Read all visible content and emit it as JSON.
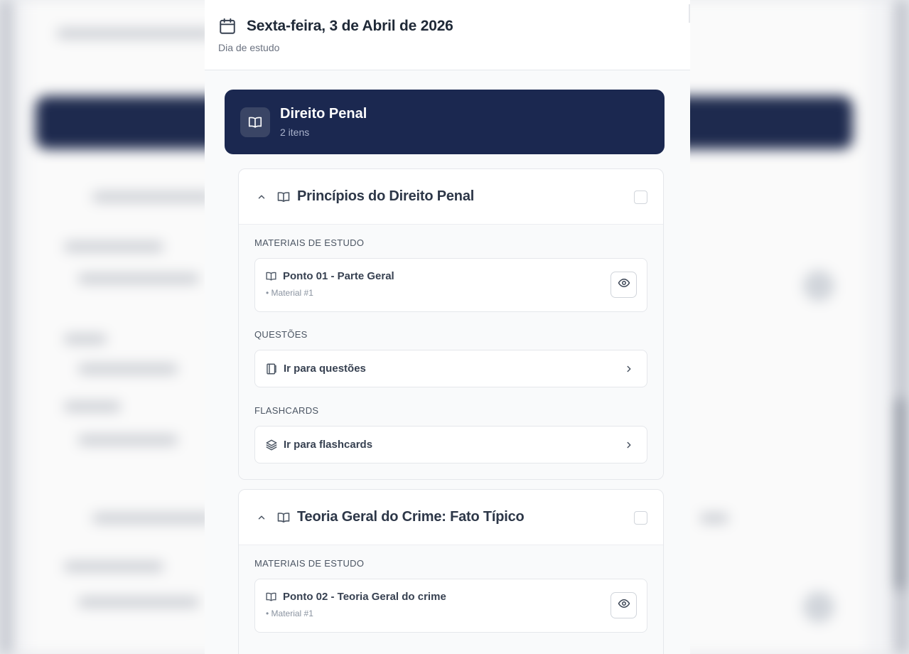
{
  "header": {
    "date_title": "Sexta-feira, 3 de Abril de 2026",
    "subtitle": "Dia de estudo",
    "icon": "calendar-icon"
  },
  "subject": {
    "title": "Direito Penal",
    "count": "2 itens",
    "icon": "book-open-icon",
    "color": "#1b2850"
  },
  "topics": [
    {
      "title": "Princípios do Direito Penal",
      "materials_label": "MATERIAIS DE ESTUDO",
      "material_title": "Ponto 01 - Parte Geral",
      "material_sub": "• Material #1",
      "questions_label": "QUESTÕES",
      "questions_link": "Ir para questões",
      "flashcards_label": "FLASHCARDS",
      "flashcards_link": "Ir para flashcards"
    },
    {
      "title": "Teoria Geral do Crime: Fato Típico",
      "materials_label": "MATERIAIS DE ESTUDO",
      "material_title": "Ponto 02 - Teoria Geral do crime",
      "material_sub": "• Material #1"
    }
  ]
}
